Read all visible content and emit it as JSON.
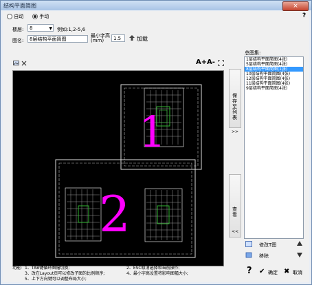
{
  "window": {
    "title": "结构平面简图",
    "close_label": "×",
    "help_label": "?"
  },
  "mode": {
    "auto_label": "自动",
    "manual_label": "手动"
  },
  "floor": {
    "label": "楼层:",
    "value": "8",
    "example": "例如:1,2-5,6"
  },
  "figname": {
    "label": "图名:",
    "value": "8层结构平面简图"
  },
  "minfont": {
    "label_line1": "最小字高",
    "label_line2": "(mm)",
    "value": "1.5"
  },
  "load": {
    "label": "加载"
  },
  "toolbar": {
    "zoom_in": "A+",
    "zoom_out": "A-"
  },
  "side": {
    "save_list": "保存至列表",
    "save_list_arrows": ">>",
    "view": "查看",
    "view_arrows": "<<"
  },
  "drawing": {
    "label1": "1",
    "label2": "2",
    "label_color": "#ff00ff"
  },
  "panel": {
    "title": "总图集:",
    "items": [
      "1层结构平面简图(4张)",
      "5层结构平面简图(4张)",
      "8层结构平面简图(1张)",
      "10层结构平面简图(4张)",
      "12层结构平面简图(4张)",
      "11层结构平面简图(4张)",
      "9层结构平面简图(4张)"
    ],
    "selected_index": 2
  },
  "actions": {
    "modify_label": "修改T图",
    "delete_label": "移除",
    "ok_label": "确定",
    "cancel_label": "取消"
  },
  "info": {
    "heading": "功能:",
    "lines": [
      "1、TAB键循环图幅切换;",
      "3、改在Layout页可以修改子图的比例顺序;",
      "5、上下方向键可以调整布局大小;"
    ],
    "lines_right": [
      "2、ESC取消选择和当前操作;",
      "4、最小字高设置将影响图幅大小;"
    ]
  }
}
